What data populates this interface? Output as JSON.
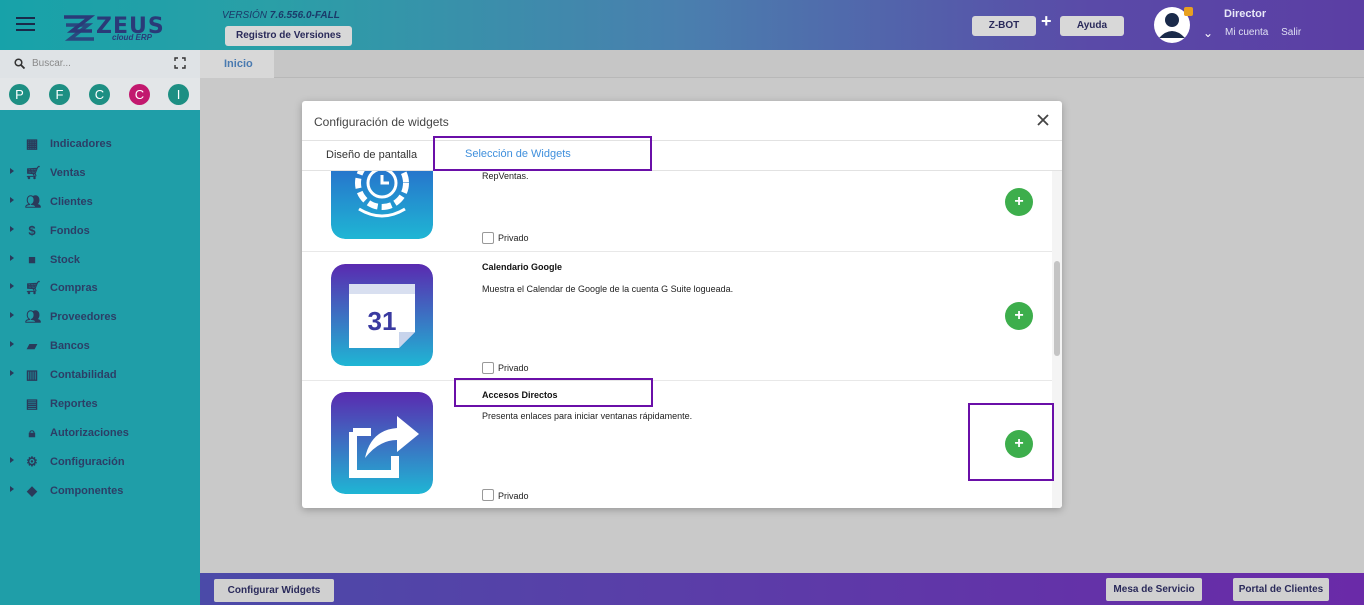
{
  "header": {
    "app_name": "ZEUS",
    "app_sub": "cloud ERP",
    "version_prefix": "VERSIÓN",
    "version_number": "7.6.556.0-FALL",
    "versions_button": "Registro de Versiones",
    "zbot_button": "Z-BOT",
    "plus": "+",
    "help_button": "Ayuda",
    "user_name": "Director",
    "account_link": "Mi cuenta",
    "logout_link": "Salir"
  },
  "sidebar": {
    "search_placeholder": "Buscar...",
    "quick_circles": [
      {
        "letter": "P",
        "color": "#1d8f83"
      },
      {
        "letter": "F",
        "color": "#1d8f83"
      },
      {
        "letter": "C",
        "color": "#1d8f83"
      },
      {
        "letter": "C",
        "color": "#c2186e"
      },
      {
        "letter": "I",
        "color": "#1d8f83"
      }
    ],
    "items": [
      {
        "label": "Indicadores",
        "icon": "dashboard-icon",
        "expandable": false
      },
      {
        "label": "Ventas",
        "icon": "cart-icon",
        "expandable": true
      },
      {
        "label": "Clientes",
        "icon": "people-icon",
        "expandable": true
      },
      {
        "label": "Fondos",
        "icon": "dollar-icon",
        "expandable": true
      },
      {
        "label": "Stock",
        "icon": "box-icon",
        "expandable": true
      },
      {
        "label": "Compras",
        "icon": "cart-add-icon",
        "expandable": true
      },
      {
        "label": "Proveedores",
        "icon": "people-icon",
        "expandable": true
      },
      {
        "label": "Bancos",
        "icon": "briefcase-icon",
        "expandable": true
      },
      {
        "label": "Contabilidad",
        "icon": "book-icon",
        "expandable": true
      },
      {
        "label": "Reportes",
        "icon": "report-icon",
        "expandable": false
      },
      {
        "label": "Autorizaciones",
        "icon": "lock-icon",
        "expandable": false
      },
      {
        "label": "Configuración",
        "icon": "gears-icon",
        "expandable": true
      },
      {
        "label": "Componentes",
        "icon": "tag-icon",
        "expandable": true
      }
    ]
  },
  "main": {
    "tab_home": "Inicio"
  },
  "modal": {
    "title": "Configuración de widgets",
    "tab_layout": "Diseño de pantalla",
    "tab_widgets": "Selección de Widgets",
    "widgets": [
      {
        "title": "",
        "desc": "RepVentas.",
        "private_label": "Privado",
        "icon": "clock-gear-icon"
      },
      {
        "title": "Calendario Google",
        "desc": "Muestra el Calendar de Google de la cuenta G Suite logueada.",
        "private_label": "Privado",
        "icon": "calendar-icon",
        "calendar_day": "31"
      },
      {
        "title": "Accesos Directos",
        "desc": "Presenta enlaces para iniciar ventanas rápidamente.",
        "private_label": "Privado",
        "icon": "share-arrow-icon"
      }
    ],
    "add_symbol": "+"
  },
  "footer": {
    "configure_button": "Configurar Widgets",
    "service_button": "Mesa de Servicio",
    "portal_button": "Portal de Clientes"
  },
  "colors": {
    "sidebar": "#1f9ea8",
    "add_button": "#3dae4c",
    "highlight": "#6a0fa8",
    "active_tab": "#3f8fdc"
  }
}
